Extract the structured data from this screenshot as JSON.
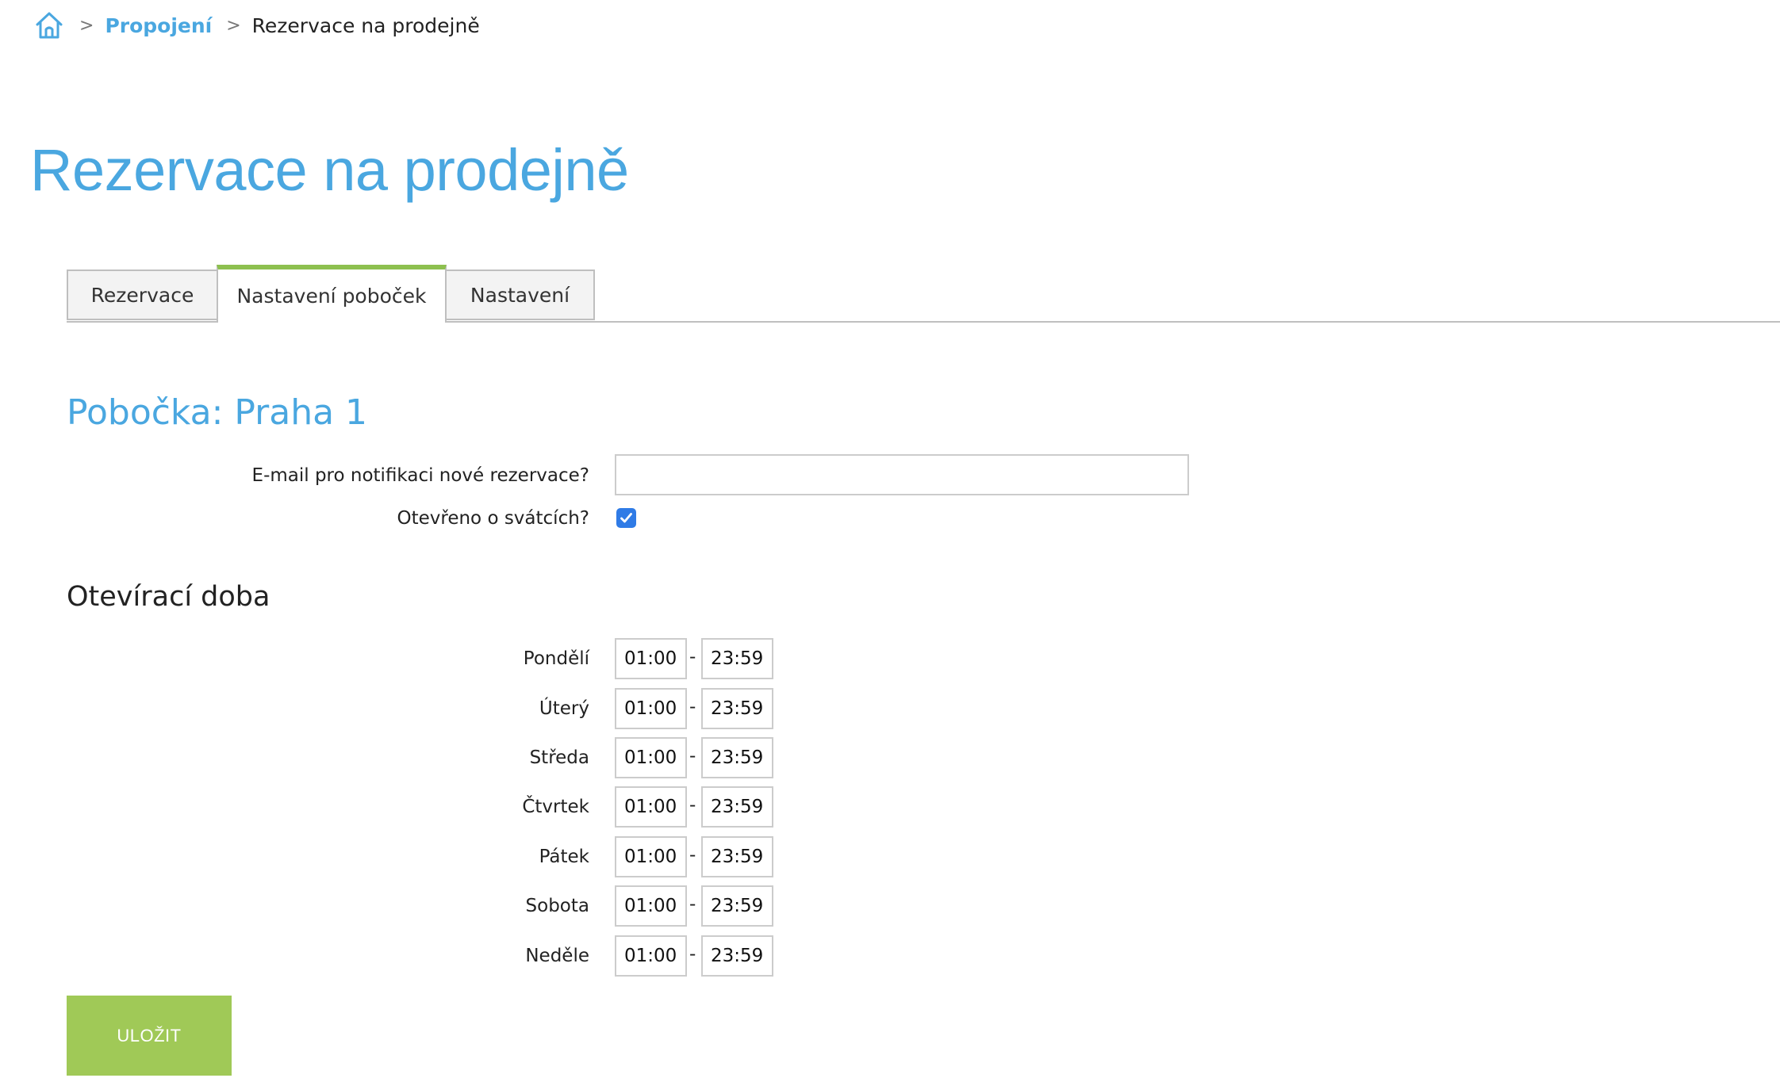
{
  "breadcrumb": {
    "home_icon": "home-icon",
    "separator": ">",
    "items": [
      {
        "label": "Propojení"
      },
      {
        "label": "Rezervace na prodejně"
      }
    ]
  },
  "page": {
    "title": "Rezervace na prodejně"
  },
  "tabs": [
    {
      "label": "Rezervace",
      "active": false
    },
    {
      "label": "Nastavení poboček",
      "active": true
    },
    {
      "label": "Nastavení",
      "active": false
    }
  ],
  "branch": {
    "title": "Pobočka: Praha 1",
    "email_label": "E-mail pro notifikaci nové rezervace?",
    "email_value": "",
    "holidays_label": "Otevřeno o svátcích?",
    "holidays_checked": true
  },
  "opening_hours": {
    "title": "Otevírací doba",
    "separator": "-",
    "days": [
      {
        "label": "Pondělí",
        "from": "01:00",
        "to": "23:59"
      },
      {
        "label": "Úterý",
        "from": "01:00",
        "to": "23:59"
      },
      {
        "label": "Středa",
        "from": "01:00",
        "to": "23:59"
      },
      {
        "label": "Čtvrtek",
        "from": "01:00",
        "to": "23:59"
      },
      {
        "label": "Pátek",
        "from": "01:00",
        "to": "23:59"
      },
      {
        "label": "Sobota",
        "from": "01:00",
        "to": "23:59"
      },
      {
        "label": "Neděle",
        "from": "01:00",
        "to": "23:59"
      }
    ]
  },
  "actions": {
    "save_label": "ULOŽIT"
  },
  "colors": {
    "accent_blue": "#4aa7e0",
    "active_tab_green": "#8dc04f",
    "save_green": "#a0c957",
    "checkbox_blue": "#2f7be6"
  }
}
